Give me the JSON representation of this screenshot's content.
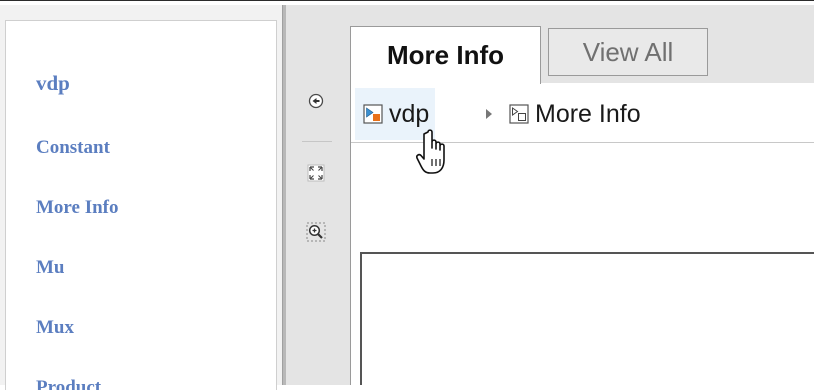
{
  "sidebar": {
    "title": "vdp",
    "items": [
      {
        "label": "Constant"
      },
      {
        "label": "More Info"
      },
      {
        "label": "Mu"
      },
      {
        "label": "Mux"
      },
      {
        "label": "Product"
      }
    ]
  },
  "toolbar": {
    "icons": [
      "back-icon",
      "fit-to-view-icon",
      "zoom-icon"
    ]
  },
  "tabs": [
    {
      "label": "More Info",
      "active": true
    },
    {
      "label": "View All",
      "active": false
    }
  ],
  "breadcrumb": {
    "items": [
      {
        "label": "vdp",
        "icon": "model-icon"
      },
      {
        "label": "More Info",
        "icon": "subsystem-icon"
      }
    ]
  },
  "colors": {
    "link": "#5b7ec0",
    "hover": "#eaf3fb",
    "panel_bg": "#e4e4e4"
  }
}
